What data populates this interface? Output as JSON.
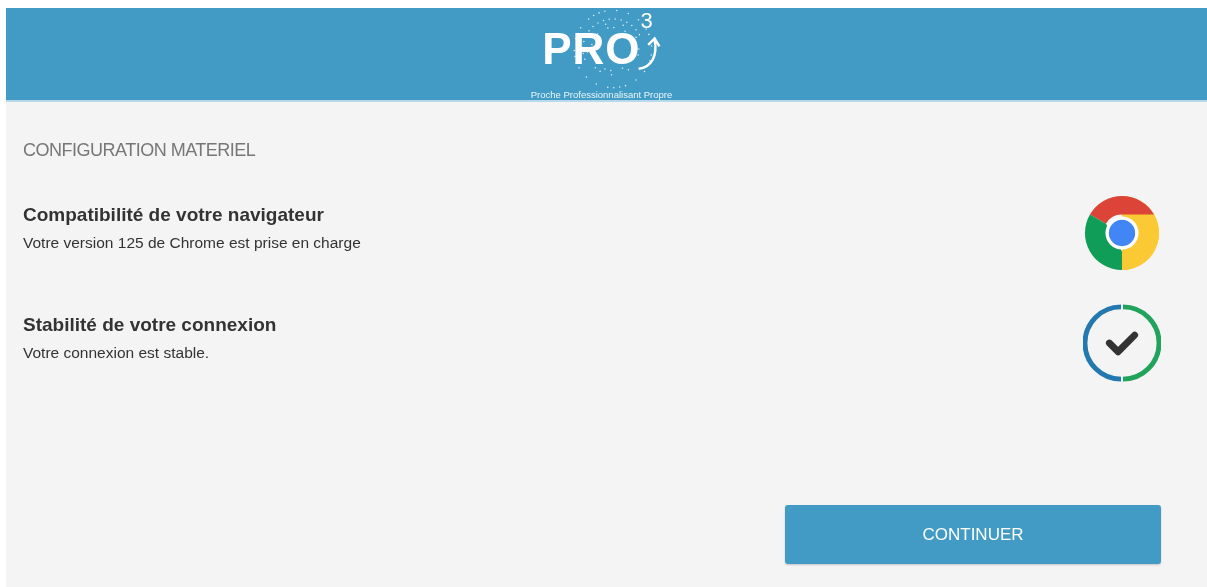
{
  "header": {
    "logo_text": "PRO",
    "logo_superscript": "3",
    "tagline": "Proche Professionnalisant Propre"
  },
  "section_title": "CONFIGURATION MATERIEL",
  "checks": [
    {
      "kind": "browser",
      "title": "Compatibilité de votre navigateur",
      "description": "Votre version 125 de Chrome est prise en charge"
    },
    {
      "kind": "connection",
      "title": "Stabilité de votre connexion",
      "description": "Votre connexion est stable."
    }
  ],
  "button": "CONTINUER"
}
